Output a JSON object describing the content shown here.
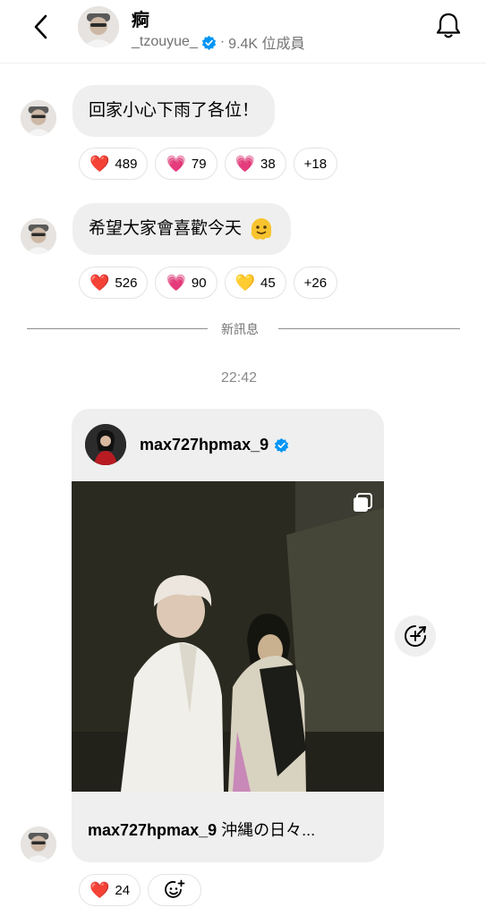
{
  "header": {
    "title": "痾",
    "username": "_tzouyue_",
    "separator": "·",
    "members": "9.4K 位成員"
  },
  "messages": [
    {
      "text": "回家小心下雨了各位！",
      "reactions": [
        {
          "emoji": "❤️",
          "count": "489"
        },
        {
          "emoji": "💗",
          "count": "79"
        },
        {
          "emoji": "💗",
          "count": "38"
        },
        {
          "emoji": "",
          "count": "+18"
        }
      ]
    },
    {
      "text": "希望大家會喜歡今天",
      "reactions": [
        {
          "emoji": "❤️",
          "count": "526"
        },
        {
          "emoji": "💗",
          "count": "90"
        },
        {
          "emoji": "💛",
          "count": "45"
        },
        {
          "emoji": "",
          "count": "+26"
        }
      ]
    }
  ],
  "divider": {
    "label": "新訊息"
  },
  "timestamp": "22:42",
  "shared_post": {
    "username": "max727hpmax_9",
    "caption_user": "max727hpmax_9",
    "caption_text": "沖縄の日々..."
  },
  "post_reactions": [
    {
      "emoji": "❤️",
      "count": "24"
    }
  ],
  "colors": {
    "verified": "#0095f6",
    "bubble": "#efefef"
  }
}
